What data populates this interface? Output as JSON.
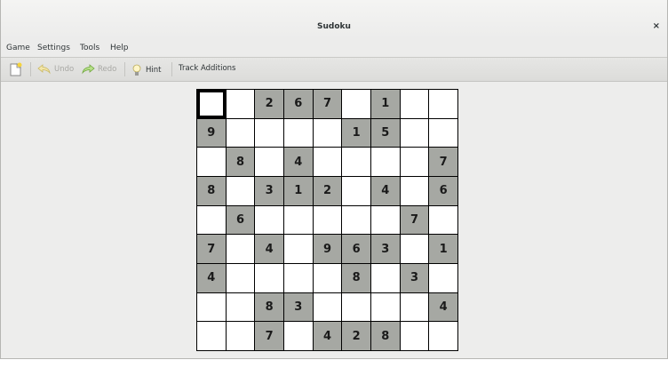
{
  "window": {
    "title": "Sudoku",
    "close_glyph": "×"
  },
  "menu": [
    "Game",
    "Settings",
    "Tools",
    "Help"
  ],
  "toolbar": {
    "new_icon": "new-game-icon",
    "undo_label": "Undo",
    "redo_label": "Redo",
    "hint_label": "Hint",
    "track_label": "Track Additions"
  },
  "board": [
    [
      "",
      "",
      "2",
      "6",
      "7",
      "",
      "1",
      "",
      ""
    ],
    [
      "9",
      "",
      "",
      "",
      "",
      "1",
      "5",
      "",
      ""
    ],
    [
      "",
      "8",
      "",
      "4",
      "",
      "",
      "",
      "",
      "7"
    ],
    [
      "8",
      "",
      "3",
      "1",
      "2",
      "",
      "4",
      "",
      "6"
    ],
    [
      "",
      "6",
      "",
      "",
      "",
      "",
      "",
      "7",
      ""
    ],
    [
      "7",
      "",
      "4",
      "",
      "9",
      "6",
      "3",
      "",
      "1"
    ],
    [
      "4",
      "",
      "",
      "",
      "",
      "8",
      "",
      "3",
      ""
    ],
    [
      "",
      "",
      "8",
      "3",
      "",
      "",
      "",
      "",
      "4"
    ],
    [
      "",
      "",
      "7",
      "",
      "4",
      "2",
      "8",
      "",
      ""
    ]
  ],
  "selected_cell": [
    0,
    0
  ]
}
